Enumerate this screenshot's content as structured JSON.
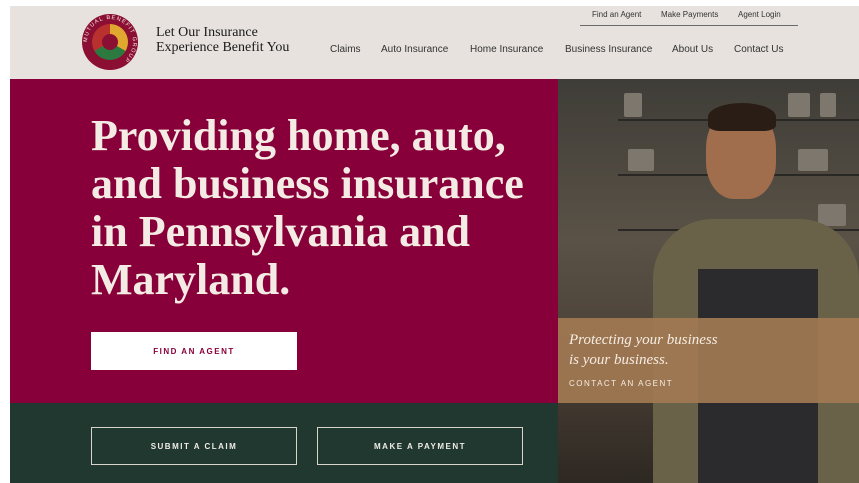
{
  "brand": {
    "tagline": "Let Our Insurance\nExperience Benefit You",
    "logo_text": "MUTUAL BENEFIT GROUP"
  },
  "utility_nav": [
    "Find an Agent",
    "Make Payments",
    "Agent Login"
  ],
  "main_nav": [
    "Claims",
    "Auto Insurance",
    "Home Insurance",
    "Business Insurance",
    "About Us",
    "Contact Us"
  ],
  "hero": {
    "title": "Providing home, auto, and business insurance in Pennsylvania and Maryland.",
    "cta_label": "FIND AN AGENT"
  },
  "promo": {
    "title": "Protecting your business\nis your business.",
    "link_label": "CONTACT AN AGENT"
  },
  "actions": {
    "claim_label": "SUBMIT A CLAIM",
    "payment_label": "MAKE A PAYMENT"
  },
  "colors": {
    "hero_bg": "#87003a",
    "header_bg": "#e7e2dd",
    "bottom_bg": "#203830",
    "promo_bg": "#a07852"
  }
}
